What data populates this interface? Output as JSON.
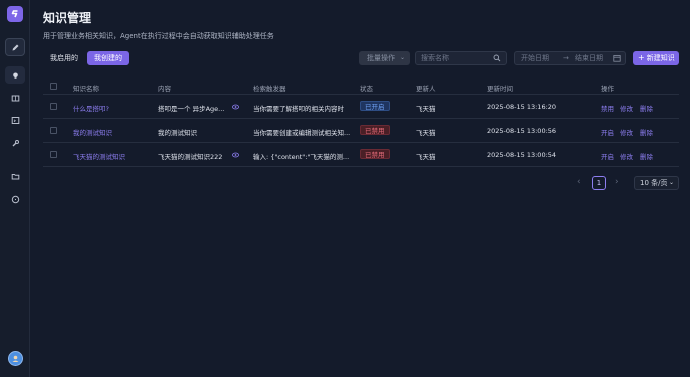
{
  "page": {
    "title": "知识管理",
    "subtitle": "用于管理业务相关知识，Agent在执行过程中会自动获取知识辅助处理任务"
  },
  "tabs": [
    {
      "label": "我启用的",
      "active": false
    },
    {
      "label": "我创建的",
      "active": true
    }
  ],
  "toolbar": {
    "batch_label": "批量操作",
    "search_placeholder": "搜索名称",
    "start_date_placeholder": "开始日期",
    "date_arrow": "→",
    "end_date_placeholder": "结束日期",
    "new_label": "新建知识"
  },
  "table": {
    "headers": [
      "知识名称",
      "内容",
      "检索触发器",
      "状态",
      "更新人",
      "更新时间",
      "操作"
    ],
    "rows": [
      {
        "name": "什么是搭叩?",
        "content": "搭叩是一个 异步Age...",
        "trigger": "当你需要了解搭叩的相关内容时",
        "status": "已开启",
        "status_type": "on",
        "updater": "飞天猫",
        "time": "2025-08-15 13:16:20",
        "actions": [
          "禁用",
          "修改",
          "删除"
        ]
      },
      {
        "name": "我的测试知识",
        "content": "我的测试知识",
        "trigger": "当你需要创建或编辑测试相关知...",
        "status": "已禁用",
        "status_type": "off",
        "updater": "飞天猫",
        "time": "2025-08-15 13:00:56",
        "actions": [
          "开启",
          "修改",
          "删除"
        ]
      },
      {
        "name": "飞天猫的测试知识",
        "content": "飞天猫的测试知识222",
        "trigger": "输入: {\"content\":\"飞天猫的测...",
        "status": "已禁用",
        "status_type": "off",
        "updater": "飞天猫",
        "time": "2025-08-15 13:00:54",
        "actions": [
          "开启",
          "修改",
          "删除"
        ]
      }
    ]
  },
  "pagination": {
    "prev": "‹",
    "current": "1",
    "next": "›",
    "page_size": "10 条/页"
  },
  "colors": {
    "accent": "#7b66e6",
    "status_on": "#6ea0f2",
    "status_off": "#e36b79"
  }
}
